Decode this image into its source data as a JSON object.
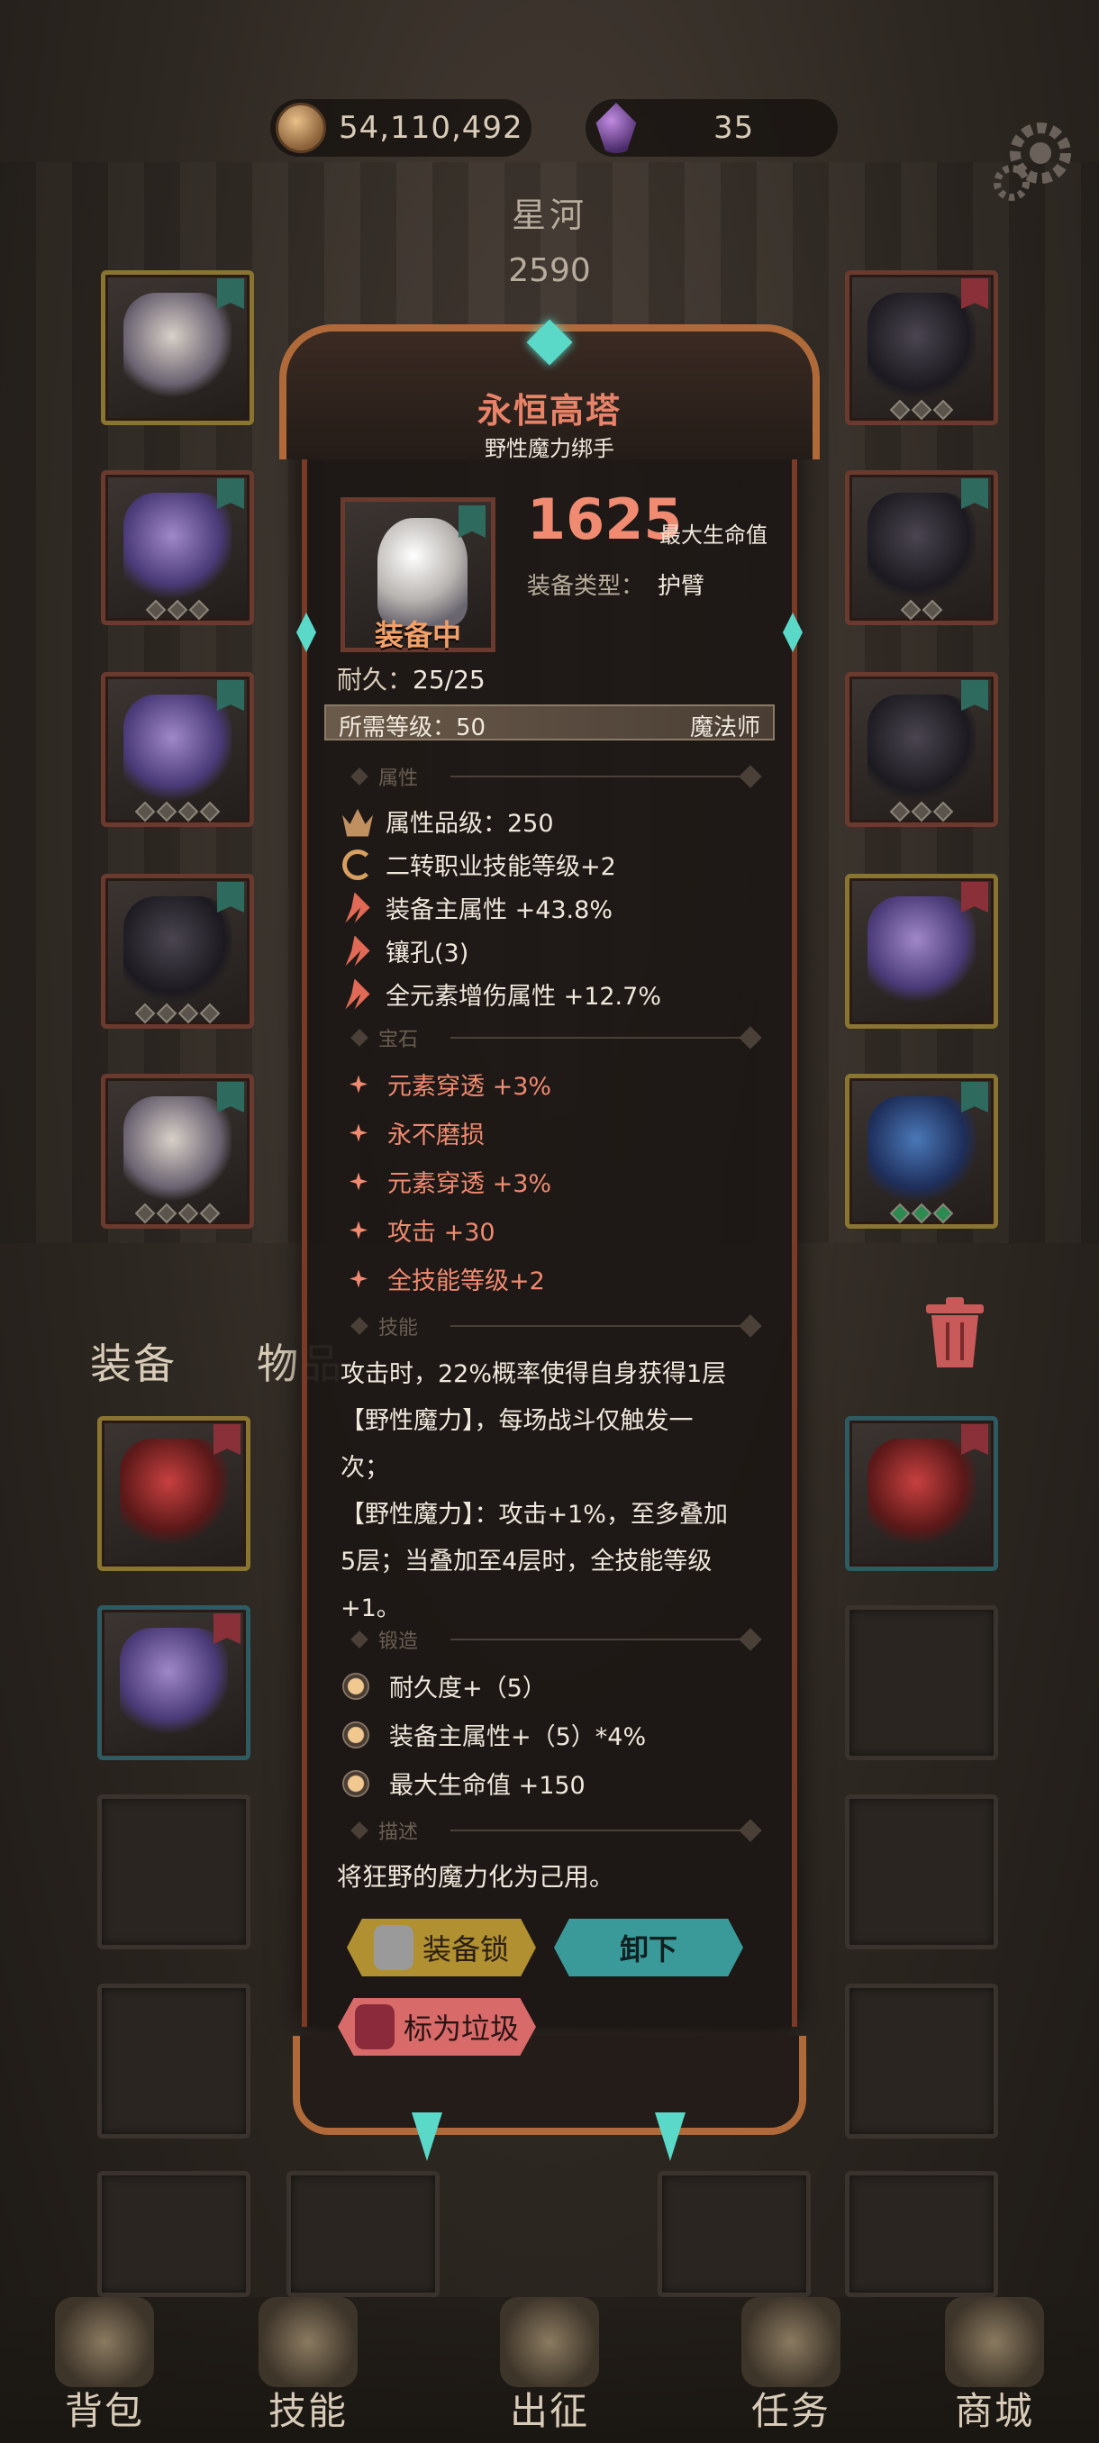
{
  "resources": {
    "gold": "54,110,492",
    "gems": "35"
  },
  "character": {
    "name": "星河",
    "power": "2590"
  },
  "tabs": {
    "equipment": "装备",
    "items": "物品"
  },
  "item": {
    "name": "永恒高塔",
    "subtitle": "野性魔力绑手",
    "equipped_label": "装备中",
    "main_stat_value": "1625",
    "main_stat_label": "最大生命值",
    "type_label": "装备类型：",
    "type_value": "护臂",
    "durability_label": "耐久：",
    "durability_value": "25/25",
    "required_level": "所需等级：50",
    "class": "魔法师",
    "sections": {
      "attributes": "属性",
      "gems": "宝石",
      "skill": "技能",
      "forge": "锻造",
      "description": "描述"
    },
    "attributes": [
      {
        "icon": "crown-icon",
        "text": "属性品级：250"
      },
      {
        "icon": "cycle-icon",
        "text": "二转职业技能等级+2"
      },
      {
        "icon": "arrow-icon",
        "text": "装备主属性 +43.8%"
      },
      {
        "icon": "arrow-icon",
        "text": "镶孔(3)"
      },
      {
        "icon": "arrow-icon",
        "text": "全元素增伤属性 +12.7%"
      }
    ],
    "gems": [
      "元素穿透 +3%",
      "永不磨损",
      "元素穿透 +3%",
      "攻击 +30",
      "全技能等级+2"
    ],
    "skill_lines": [
      "攻击时，22%概率使得自身获得1层",
      "【野性魔力】，每场战斗仅触发一",
      "次；",
      "【野性魔力】：攻击+1%，至多叠加",
      "5层；当叠加至4层时，全技能等级",
      "+1。"
    ],
    "forge": [
      "耐久度+（5）",
      "装备主属性+（5）*4%",
      "最大生命值 +150"
    ],
    "description": "将狂野的魔力化为己用。"
  },
  "buttons": {
    "lock": "装备锁",
    "unequip": "卸下",
    "mark_trash": "标为垃圾"
  },
  "nav": [
    "背包",
    "技能",
    "出征",
    "任务",
    "商城"
  ],
  "colors": {
    "item_name": "#e8836a",
    "accent_teal": "#3a9a9a",
    "gold_button": "#b09030",
    "trash_button": "#d86a6a"
  }
}
